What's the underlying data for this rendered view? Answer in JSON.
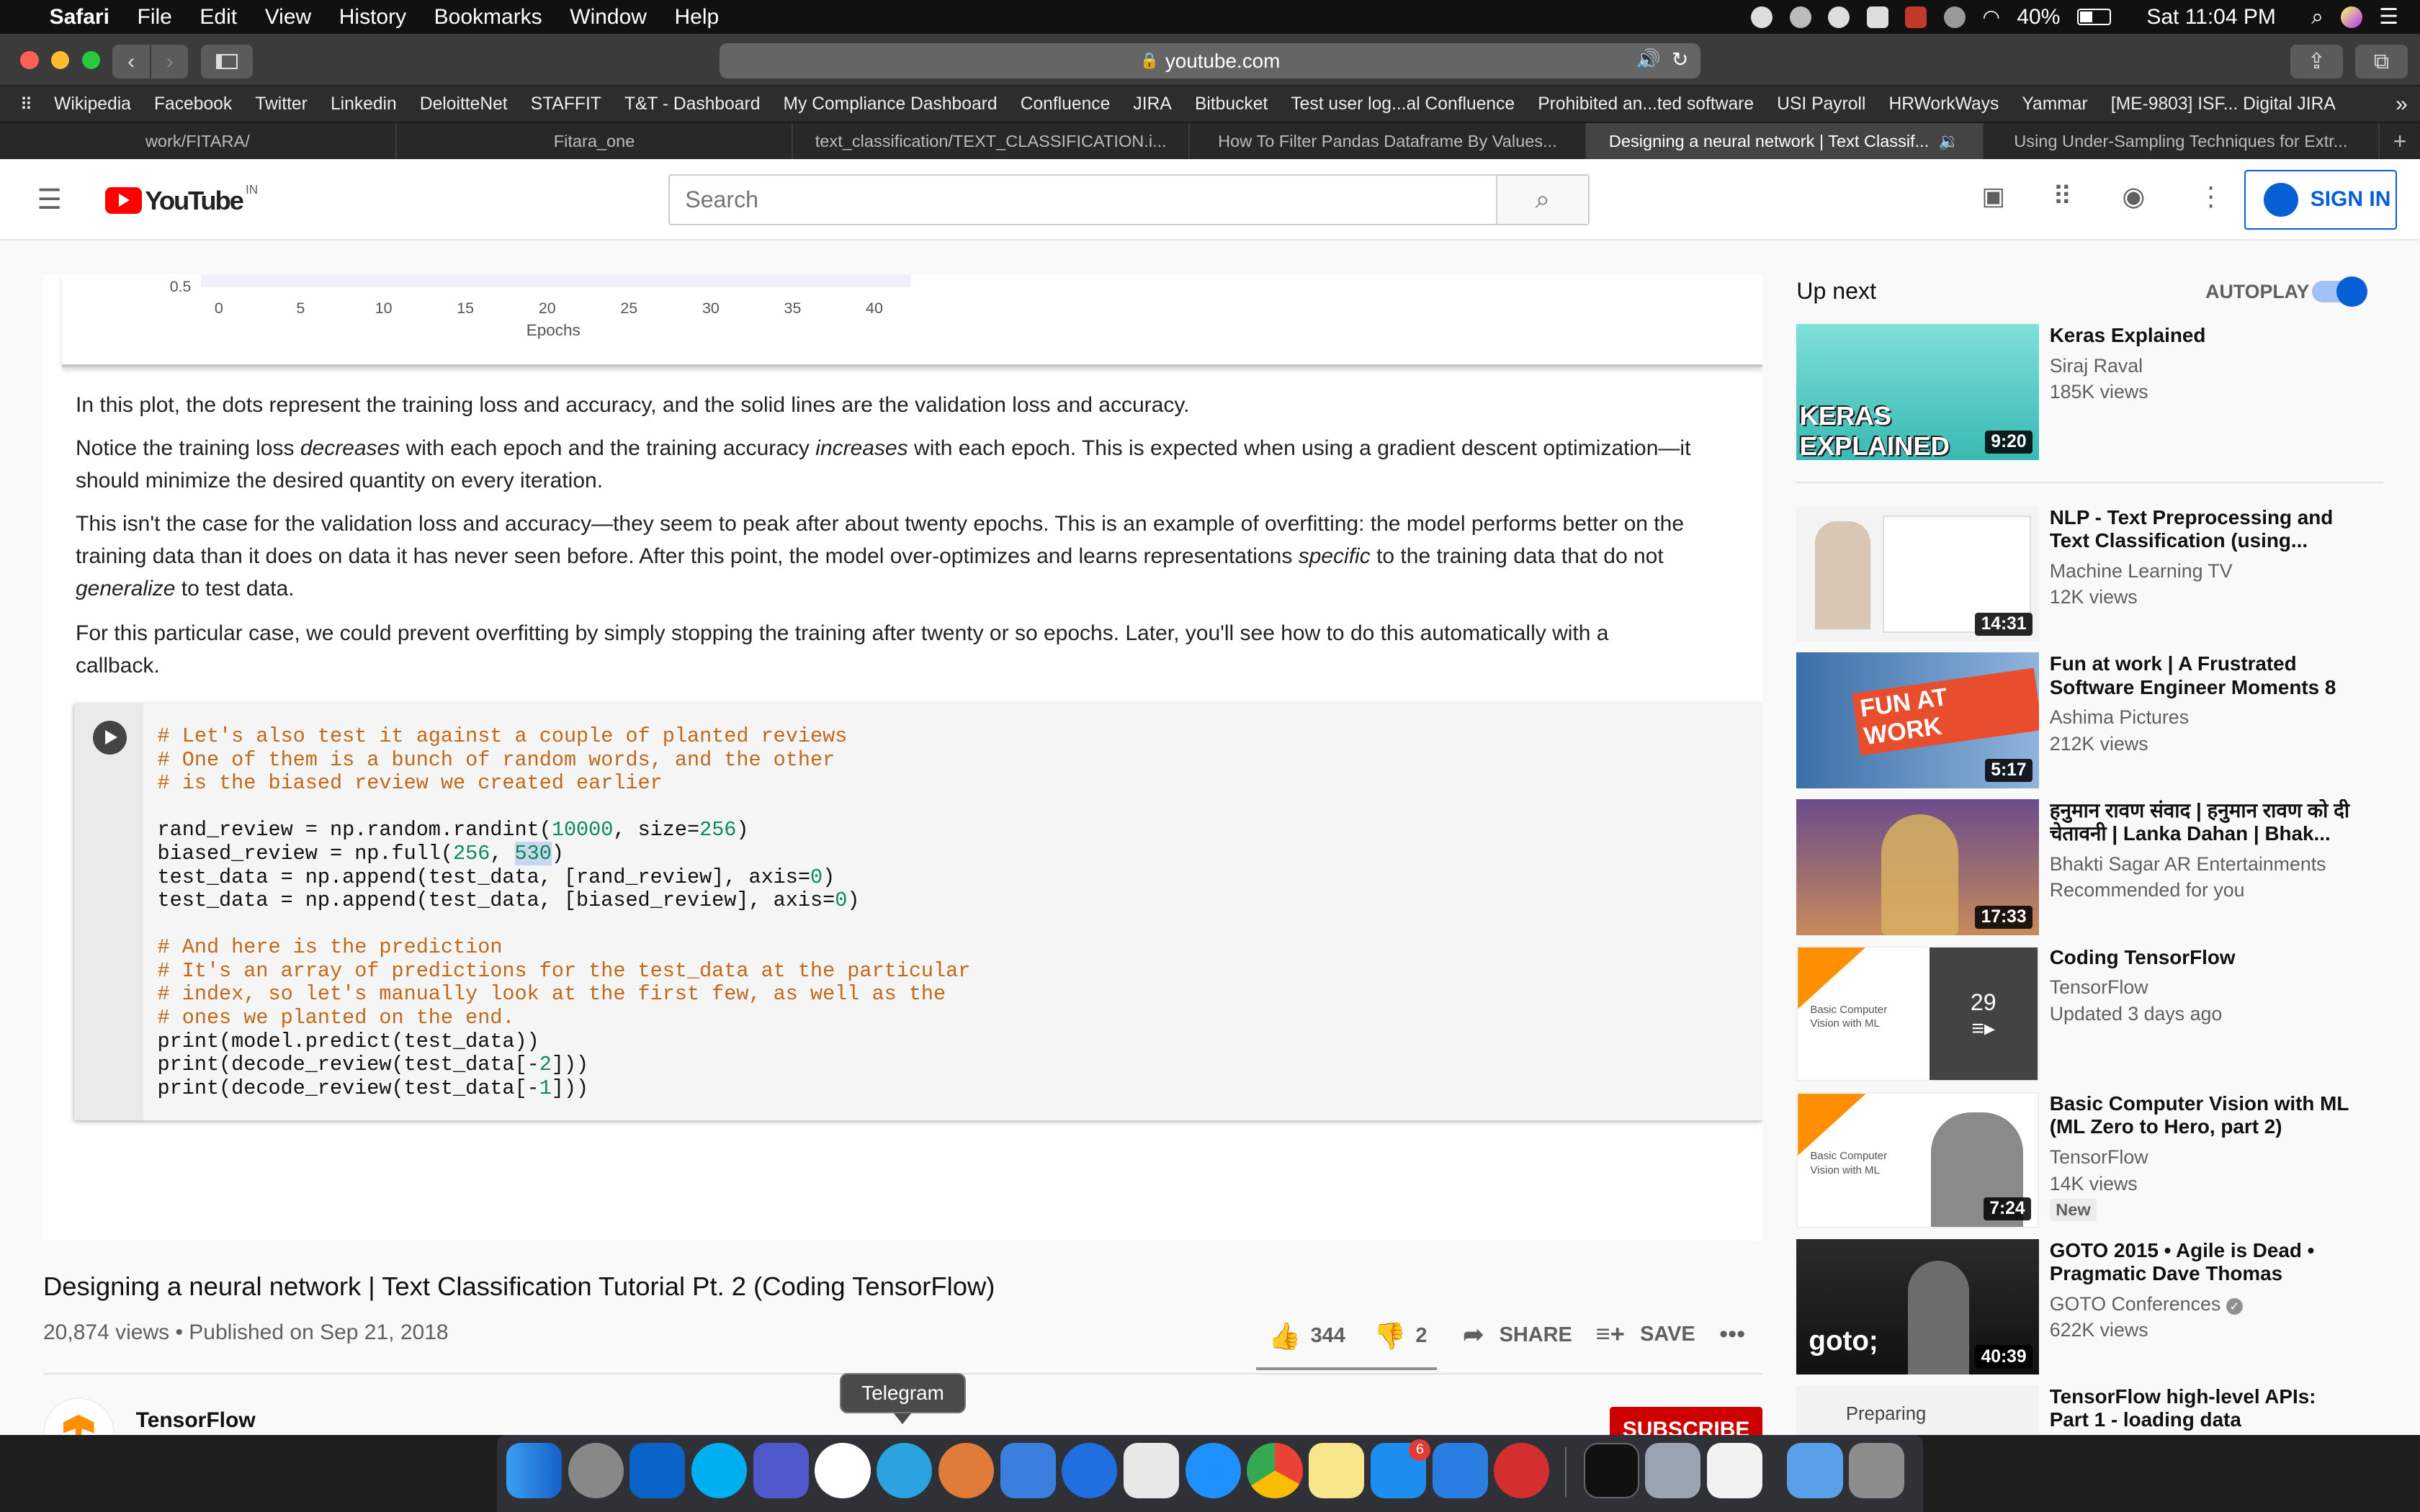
{
  "menubar": {
    "app": "Safari",
    "menus": [
      "File",
      "Edit",
      "View",
      "History",
      "Bookmarks",
      "Window",
      "Help"
    ],
    "battery": "40%",
    "clock": "Sat 11:04 PM"
  },
  "browser": {
    "url": "youtube.com",
    "favorites": [
      "Wikipedia",
      "Facebook",
      "Twitter",
      "Linkedin",
      "DeloitteNet",
      "STAFFIT",
      "T&T - Dashboard",
      "My Compliance Dashboard",
      "Confluence",
      "JIRA",
      "Bitbucket",
      "Test user log...al Confluence",
      "Prohibited an...ted software",
      "USI Payroll",
      "HRWorkWays",
      "Yammar",
      "[ME-9803] ISF... Digital JIRA"
    ],
    "tabs": [
      "work/FITARA/",
      "Fitara_one",
      "text_classification/TEXT_CLASSIFICATION.i...",
      "How To Filter Pandas Dataframe By Values...",
      "Designing a neural network | Text Classif...",
      "Using Under-Sampling Techniques for Extr..."
    ]
  },
  "youtube": {
    "logo": "YouTube",
    "region": "IN",
    "search_placeholder": "Search",
    "sign_in": "SIGN IN"
  },
  "frame": {
    "axis_ticks": [
      "0",
      "5",
      "10",
      "15",
      "20",
      "25",
      "30",
      "35",
      "40"
    ],
    "y_tick": "0.5",
    "axis_label": "Epochs",
    "p1": "In this plot, the dots represent the training loss and accuracy, and the solid lines are the validation loss and accuracy.",
    "p2a": "Notice the training loss ",
    "p2b": "decreases",
    "p2c": " with each epoch and the training accuracy ",
    "p2d": "increases",
    "p2e": " with each epoch. This is expected when using a gradient descent optimization—it should minimize the desired quantity on every iteration.",
    "p3a": "This isn't the case for the validation loss and accuracy—they seem to peak after about twenty epochs. This is an example of overfitting: the model performs better on the training data than it does on data it has never seen before. After this point, the model over-optimizes and learns representations ",
    "p3b": "specific",
    "p3c": " to the training data that do not ",
    "p3d": "generalize",
    "p3e": " to test data.",
    "p4": "For this particular case, we could prevent overfitting by simply stopping the training after twenty or so epochs. Later, you'll see how to do this automatically with a callback.",
    "code": {
      "c1": "# Let's also test it against a couple of planted reviews",
      "c2": "# One of them is a bunch of random words, and the other",
      "c3": "# is the biased review we created earlier",
      "l1a": "rand_review = np.random.randint(",
      "l1n": "10000",
      "l1b": ", size=",
      "l1m": "256",
      "l1c": ")",
      "l2a": "biased_review = np.full(",
      "l2n": "256",
      "l2b": ", ",
      "l2m": "530",
      "l2c": ")",
      "l3a": "test_data = np.append(test_data, [rand_review], axis=",
      "l3n": "0",
      "l3c": ")",
      "l4a": "test_data = np.append(test_data, [biased_review], axis=",
      "l4n": "0",
      "l4c": ")",
      "c4": "# And here is the prediction",
      "c5": "# It's an array of predictions for the test_data at the particular",
      "c6": "# index, so let's manually look at the first few, as well as the",
      "c7": "# ones we planted on the end.",
      "l5": "print(model.predict(test_data))",
      "l6a": "print(decode_review(test_data[-",
      "l6n": "2",
      "l6c": "]))",
      "l7a": "print(decode_review(test_data[-",
      "l7n": "1",
      "l7c": "]))"
    }
  },
  "video": {
    "title": "Designing a neural network | Text Classification Tutorial Pt. 2 (Coding TensorFlow)",
    "meta": "20,874 views • Published on Sep 21, 2018",
    "likes": "344",
    "dislikes": "2",
    "share": "SHARE",
    "save": "SAVE",
    "channel": "TensorFlow",
    "subscribe": "SUBSCRIBE",
    "tooltip": "Telegram"
  },
  "upnext": {
    "heading": "Up next",
    "autoplay": "AUTOPLAY",
    "items": [
      {
        "title": "Keras Explained",
        "channel": "Siraj Raval",
        "views": "185K views",
        "duration": "9:20",
        "thumb_text": "KERAS EXPLAINED"
      },
      {
        "title": "NLP - Text Preprocessing and Text Classification (using...",
        "channel": "Machine Learning TV",
        "views": "12K views",
        "duration": "14:31"
      },
      {
        "title": "Fun at work | A Frustrated Software Engineer Moments 8",
        "channel": "Ashima Pictures",
        "views": "212K views",
        "duration": "5:17",
        "thumb_text": "FUN AT WORK"
      },
      {
        "title": "हनुमान रावण संवाद | हनुमान रावण को दी चेतावनी | Lanka Dahan | Bhak...",
        "channel": "Bhakti Sagar AR Entertainments",
        "views": "Recommended for you",
        "duration": "17:33"
      },
      {
        "title": "Coding TensorFlow",
        "channel": "TensorFlow",
        "views": "Updated 3 days ago",
        "playlist_count": "29",
        "thumb_text": "Basic Computer Vision with ML"
      },
      {
        "title": "Basic Computer Vision with ML (ML Zero to Hero, part 2)",
        "channel": "TensorFlow",
        "views": "14K views",
        "badge": "New",
        "duration": "7:24",
        "thumb_text": "Basic Computer Vision with ML"
      },
      {
        "title": "GOTO 2015 • Agile is Dead • Pragmatic Dave Thomas",
        "channel": "GOTO Conferences",
        "views": "622K views",
        "duration": "40:39",
        "thumb_text": "goto;"
      },
      {
        "title": "TensorFlow high-level APIs: Part 1 - loading data",
        "thumb_text": "Preparing"
      }
    ]
  },
  "dock": {
    "badge": "6"
  }
}
